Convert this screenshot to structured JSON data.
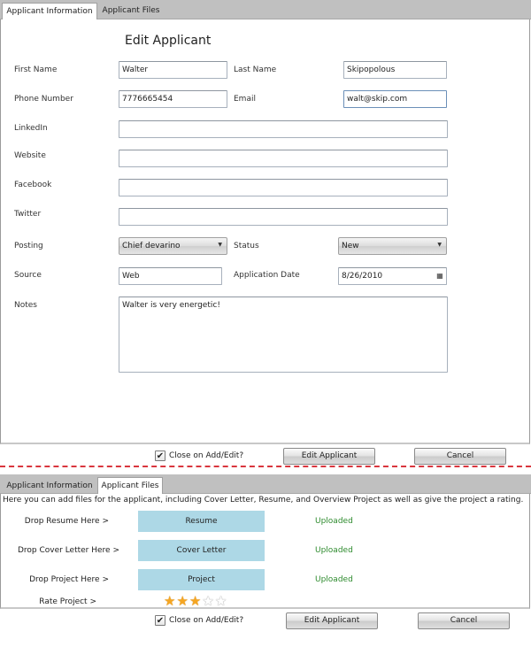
{
  "top_form": {
    "tabs": [
      {
        "label": "Applicant Information",
        "active": true
      },
      {
        "label": "Applicant Files",
        "active": false
      }
    ],
    "title": "Edit Applicant",
    "fields": {
      "first_name": {
        "label": "First Name",
        "value": "Walter"
      },
      "last_name": {
        "label": "Last Name",
        "value": "Skipopolous"
      },
      "phone": {
        "label": "Phone Number",
        "value": "7776665454"
      },
      "email": {
        "label": "Email",
        "value": "walt@skip.com"
      },
      "linkedin": {
        "label": "LinkedIn",
        "value": ""
      },
      "website": {
        "label": "Website",
        "value": ""
      },
      "facebook": {
        "label": "Facebook",
        "value": ""
      },
      "twitter": {
        "label": "Twitter",
        "value": ""
      },
      "posting": {
        "label": "Posting",
        "value": "Chief devarino"
      },
      "status": {
        "label": "Status",
        "value": "New"
      },
      "source": {
        "label": "Source",
        "value": "Web"
      },
      "application_date": {
        "label": "Application Date",
        "value": "8/26/2010"
      },
      "notes": {
        "label": "Notes",
        "value": "Walter is very energetic!"
      }
    },
    "footer": {
      "close_checkbox_label": "Close on Add/Edit?",
      "close_checked": true,
      "check_glyph": "✔",
      "edit_button": "Edit Applicant",
      "cancel_button": "Cancel"
    }
  },
  "bottom_form": {
    "tabs": [
      {
        "label": "Applicant Information",
        "active": false
      },
      {
        "label": "Applicant Files",
        "active": true
      }
    ],
    "description": "Here you can add files for the applicant, including Cover Letter, Resume, and Overview Project as well as give the project a rating.",
    "files": [
      {
        "drop_label": "Drop Resume Here >",
        "zone_label": "Resume",
        "status": "Uploaded"
      },
      {
        "drop_label": "Drop Cover Letter Here >",
        "zone_label": "Cover Letter",
        "status": "Uploaded"
      },
      {
        "drop_label": "Drop Project Here >",
        "zone_label": "Project",
        "status": "Uploaded"
      }
    ],
    "rating": {
      "label": "Rate Project >",
      "value": 3,
      "max": 5,
      "star_glyph": "★"
    },
    "footer": {
      "close_checkbox_label": "Close on Add/Edit?",
      "close_checked": true,
      "check_glyph": "✔",
      "edit_button": "Edit Applicant",
      "cancel_button": "Cancel"
    }
  },
  "icons": {
    "dropdown_arrow": "▼",
    "calendar": "▦"
  },
  "colors": {
    "dropzone": "#add8e6",
    "uploaded_status": "#2e8b2e",
    "divider": "#d9363e",
    "star_filled": "#f5a623"
  }
}
